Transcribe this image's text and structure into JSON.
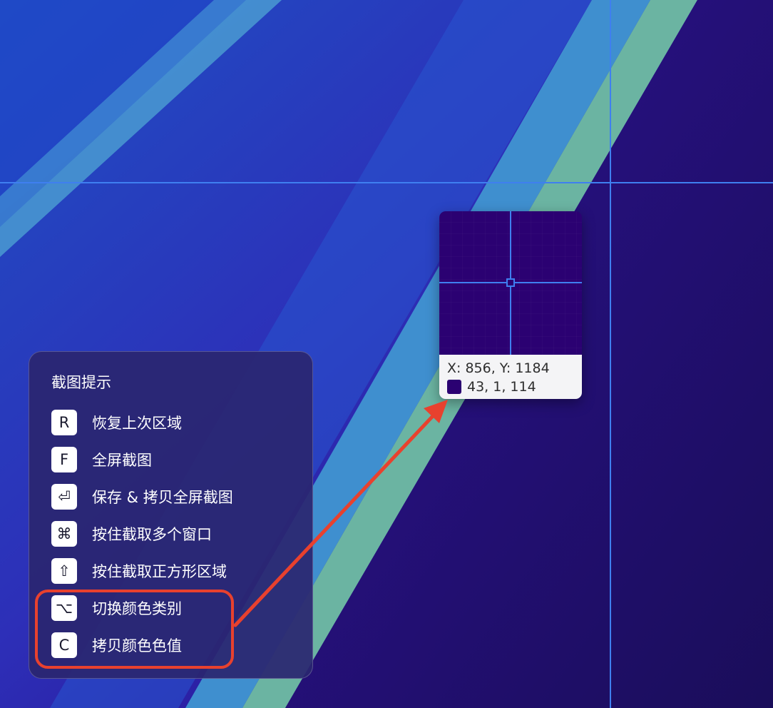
{
  "colors": {
    "guide_line": "#3f7ff0",
    "annotation_red": "#e8412e",
    "sampled_color": "#2b0172"
  },
  "magnifier": {
    "coords_text": "X: 856, Y: 1184",
    "rgb_text": "43, 1, 114"
  },
  "tips": {
    "title": "截图提示",
    "items": [
      {
        "key": "R",
        "label": "恢复上次区域"
      },
      {
        "key": "F",
        "label": "全屏截图"
      },
      {
        "key": "⏎",
        "label": "保存 & 拷贝全屏截图"
      },
      {
        "key": "⌘",
        "label": "按住截取多个窗口"
      },
      {
        "key": "⇧",
        "label": "按住截取正方形区域"
      },
      {
        "key": "⌥",
        "label": "切换颜色类别"
      },
      {
        "key": "C",
        "label": "拷贝颜色色值"
      }
    ]
  }
}
